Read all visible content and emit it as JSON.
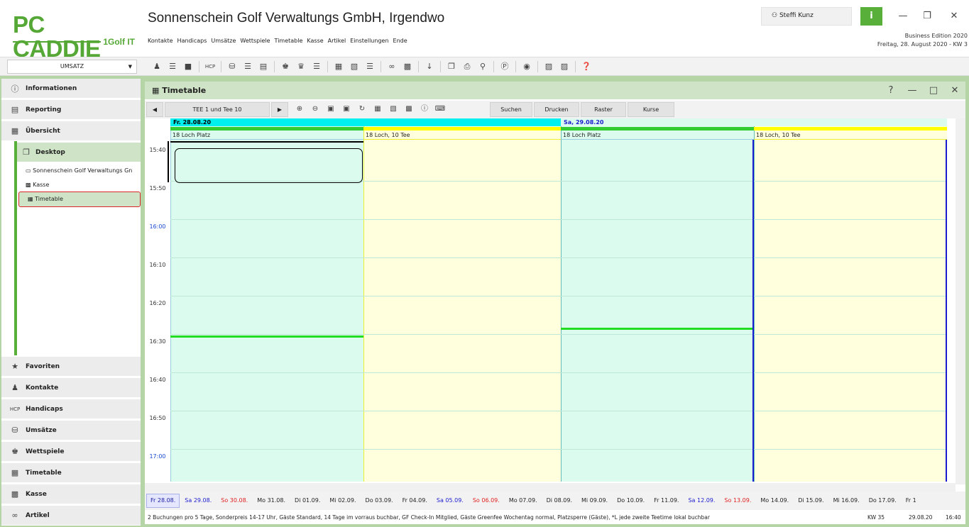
{
  "header": {
    "logo_text": "PC CADDIE",
    "logo_sub": "1Golf IT",
    "title": "Sonnenschein Golf Verwaltungs GmbH, Irgendwo",
    "menu": [
      "Kontakte",
      "Handicaps",
      "Umsätze",
      "Wettspiele",
      "Timetable",
      "Kasse",
      "Artikel",
      "Einstellungen",
      "Ende"
    ],
    "user": "Steffi Kunz",
    "info_label": "i",
    "edition": "Business Edition 2020",
    "date_line": "Freitag, 28. August 2020 - KW 3"
  },
  "toolbar": {
    "module_select": "UMSATZ",
    "icons": [
      "contact-icon",
      "list-icon",
      "book-icon",
      "hcp-icon",
      "coins-icon",
      "list-icon",
      "doc-icon",
      "trophy-icon",
      "trophy2-icon",
      "list-icon",
      "calendar-icon",
      "calendar2-icon",
      "list-icon",
      "cart-icon",
      "register-icon",
      "sort-icon",
      "window-icon",
      "print-icon",
      "lock-icon",
      "g-icon",
      "globe-icon",
      "word-icon",
      "excel-icon",
      "help-icon"
    ]
  },
  "sidebar": {
    "top": [
      {
        "icon": "info-icon",
        "label": "Informationen"
      },
      {
        "icon": "reporting-icon",
        "label": "Reporting"
      },
      {
        "icon": "overview-icon",
        "label": "Übersicht"
      }
    ],
    "desktop_label": "Desktop",
    "desktop_items": [
      "Sonnenschein Golf Verwaltungs Gn",
      "Kasse",
      "Timetable"
    ],
    "bottom": [
      {
        "icon": "star-icon",
        "label": "Favoriten"
      },
      {
        "icon": "contacts-icon",
        "label": "Kontakte"
      },
      {
        "icon": "hcp-icon",
        "label": "Handicaps"
      },
      {
        "icon": "coins-icon",
        "label": "Umsätze"
      },
      {
        "icon": "trophy-icon",
        "label": "Wettspiele"
      },
      {
        "icon": "calendar-icon",
        "label": "Timetable"
      },
      {
        "icon": "register-icon",
        "label": "Kasse"
      },
      {
        "icon": "cart-icon",
        "label": "Artikel"
      }
    ]
  },
  "timetable": {
    "title": "Timetable",
    "course_select": "TEE 1 und Tee 10",
    "buttons": {
      "suchen": "Suchen",
      "drucken": "Drucken",
      "raster": "Raster",
      "kurse": "Kurse"
    },
    "days": [
      {
        "label": "Fr. 28.08.20",
        "cols": [
          "18 Loch Platz",
          "18 Loch, 10 Tee"
        ]
      },
      {
        "label": "Sa, 29.08.20",
        "cols": [
          "18 Loch Platz",
          "18 Loch, 10 Tee"
        ]
      }
    ],
    "times": [
      "15:40",
      "15:50",
      "16:00",
      "16:10",
      "16:20",
      "16:30",
      "16:40",
      "16:50",
      "17:00"
    ],
    "dates": [
      "Fr 28.08.",
      "Sa 29.08.",
      "So 30.08.",
      "Mo 31.08.",
      "Di 01.09.",
      "Mi 02.09.",
      "Do 03.09.",
      "Fr 04.09.",
      "Sa 05.09.",
      "So 06.09.",
      "Mo 07.09.",
      "Di 08.09.",
      "Mi 09.09.",
      "Do 10.09.",
      "Fr 11.09.",
      "Sa 12.09.",
      "So 13.09.",
      "Mo 14.09.",
      "Di 15.09.",
      "Mi 16.09.",
      "Do 17.09.",
      "Fr 1"
    ],
    "status_text": "2 Buchungen pro 5 Tage, Sonderpreis 14-17 Uhr, Gäste Standard, 14 Tage im vorraus buchbar, GF Check-In Mitglied, Gäste Greenfee Wochentag normal, Platzsperre (Gäste), *L jede zweite Teetime lokal buchbar",
    "status_kw": "KW 35",
    "status_date": "29.08.20",
    "status_time": "16:40"
  }
}
